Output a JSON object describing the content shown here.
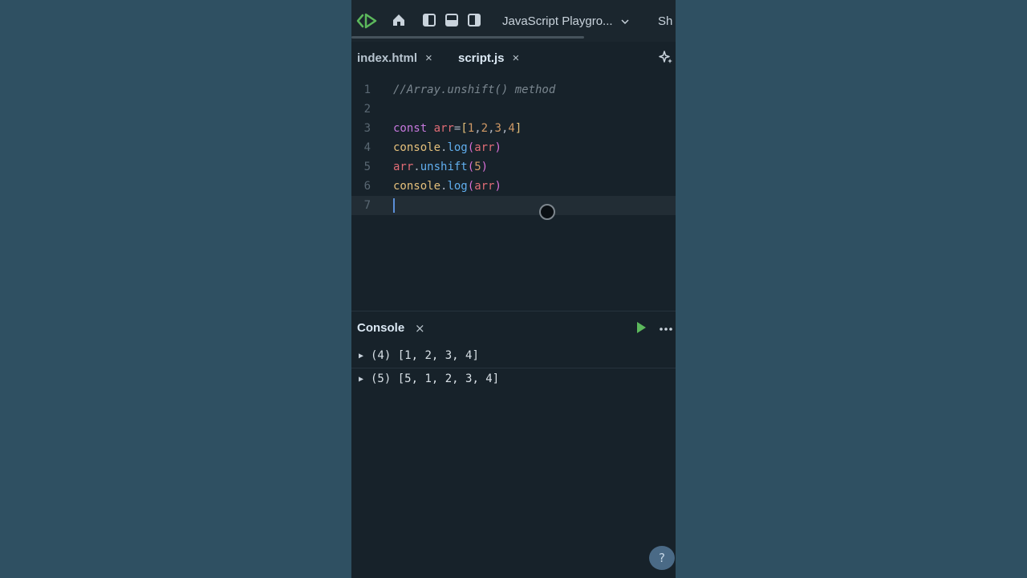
{
  "toolbar": {
    "project_name": "JavaScript Playgro...",
    "share_label": "Sh"
  },
  "tabs": [
    {
      "label": "index.html",
      "close": "×"
    },
    {
      "label": "script.js",
      "close": "×"
    }
  ],
  "editor": {
    "line_numbers": [
      "1",
      "2",
      "3",
      "4",
      "5",
      "6",
      "7"
    ],
    "comment": "//Array.unshift() method",
    "current_line": 7
  },
  "console": {
    "title": "Console",
    "close": "×",
    "more": "•••",
    "logs": [
      {
        "count": "(4)",
        "value": "[1, 2, 3, 4]"
      },
      {
        "count": "(5)",
        "value": "[5, 1, 2, 3, 4]"
      }
    ]
  },
  "help_label": "?",
  "colors": {
    "accent_green": "#5cb85c",
    "background": "#2f5062",
    "editor_bg": "#17222a"
  }
}
